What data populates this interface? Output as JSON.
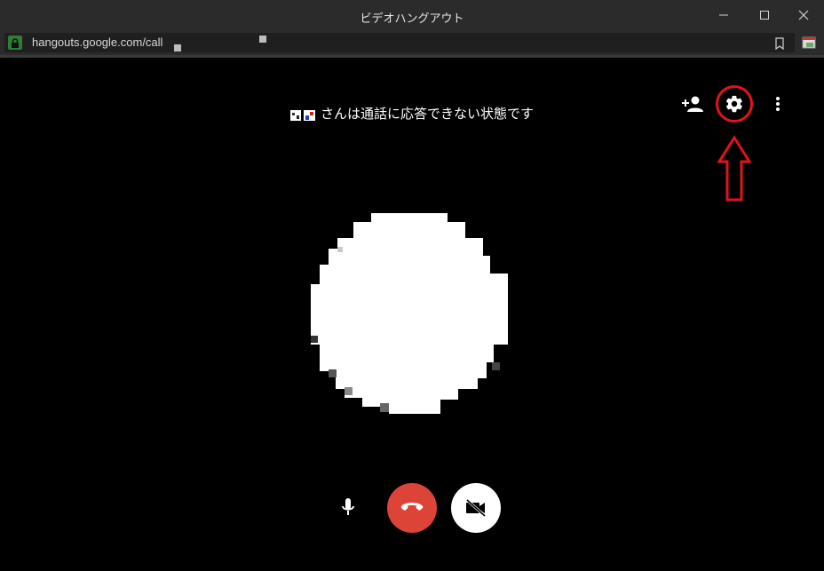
{
  "window": {
    "title": "ビデオハングアウト",
    "controls": [
      "minimize-icon",
      "maximize-icon",
      "close-icon"
    ]
  },
  "address_bar": {
    "url": "hangouts.google.com/call",
    "secure_icon": "lock-icon",
    "bookmark_icon": "bookmark-icon",
    "extension_icon": "extension-icon"
  },
  "call": {
    "status_text": "さんは通話に応答できない状態です",
    "top_controls": [
      "add-person-icon",
      "gear-icon",
      "more-vert-icon"
    ],
    "bottom_controls": [
      "microphone-icon",
      "hang-up-icon",
      "camera-off-icon"
    ],
    "colors": {
      "hangup": "#db4437",
      "highlight": "#e0141c",
      "background": "#000000"
    }
  }
}
